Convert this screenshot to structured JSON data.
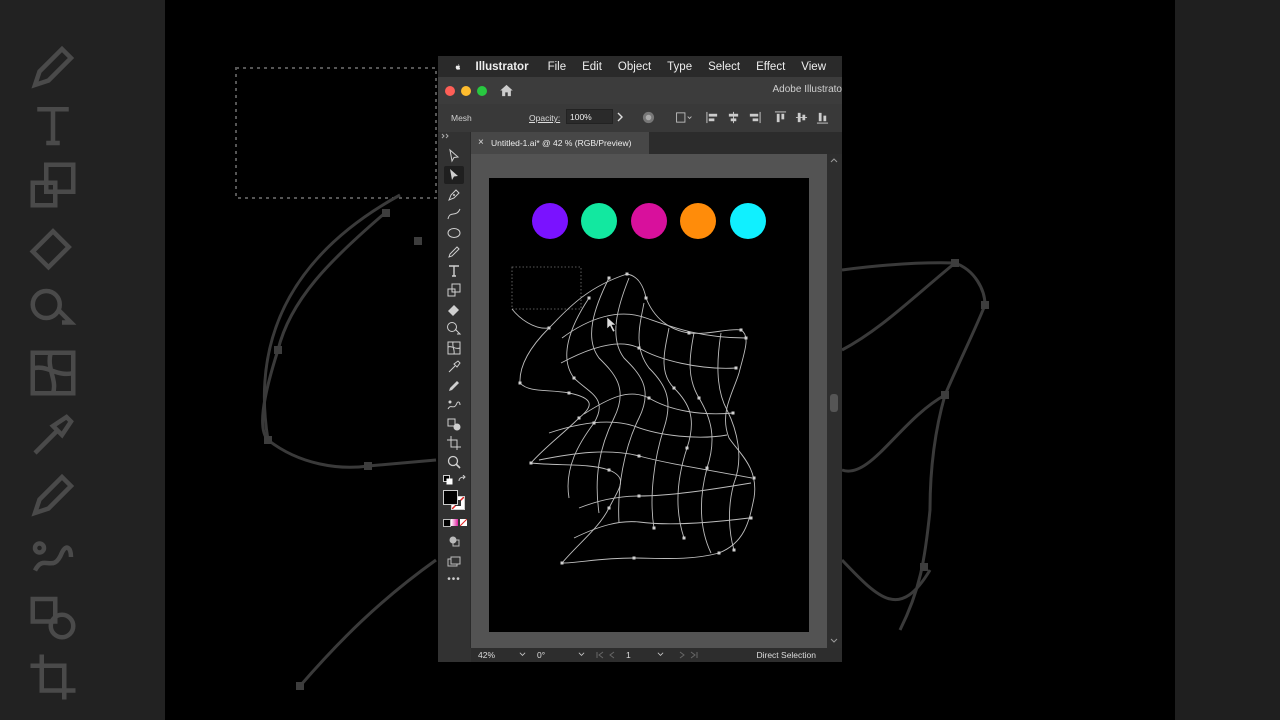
{
  "menubar": {
    "app_name": "Illustrator",
    "items": [
      "File",
      "Edit",
      "Object",
      "Type",
      "Select",
      "Effect",
      "View"
    ]
  },
  "window": {
    "title": "Adobe Illustrato",
    "traffic_lights": {
      "close": "#ff5f57",
      "minimize": "#febc2e",
      "zoom": "#28c840"
    }
  },
  "control_bar": {
    "mode_label": "Mesh",
    "opacity_label": "Opacity:",
    "opacity_value": "100%"
  },
  "document": {
    "tab_title": "Untitled-1.ai* @ 42 % (RGB/Preview)",
    "close_glyph": "×",
    "swatches": [
      "#7a12ff",
      "#12e8a0",
      "#d8109c",
      "#ff8c0a",
      "#10f0ff"
    ]
  },
  "toolbar": {
    "tools": [
      "direct-selection-tool",
      "group-selection-tool",
      "pen-tool",
      "curvature-tool",
      "ellipse-tool",
      "pencil-tool",
      "type-tool",
      "scale-tool",
      "eraser-tool",
      "shape-builder-tool",
      "mesh-tool",
      "eyedropper-tool",
      "paintbrush-tool",
      "puppet-warp-tool",
      "blend-tool",
      "artboard-tool",
      "zoom-tool"
    ],
    "fill_color": "#000000",
    "stroke_color": "#ffffff",
    "more_glyph": "•••"
  },
  "status_bar": {
    "zoom": "42%",
    "rotation": "0°",
    "page": "1",
    "current_tool": "Direct Selection"
  }
}
